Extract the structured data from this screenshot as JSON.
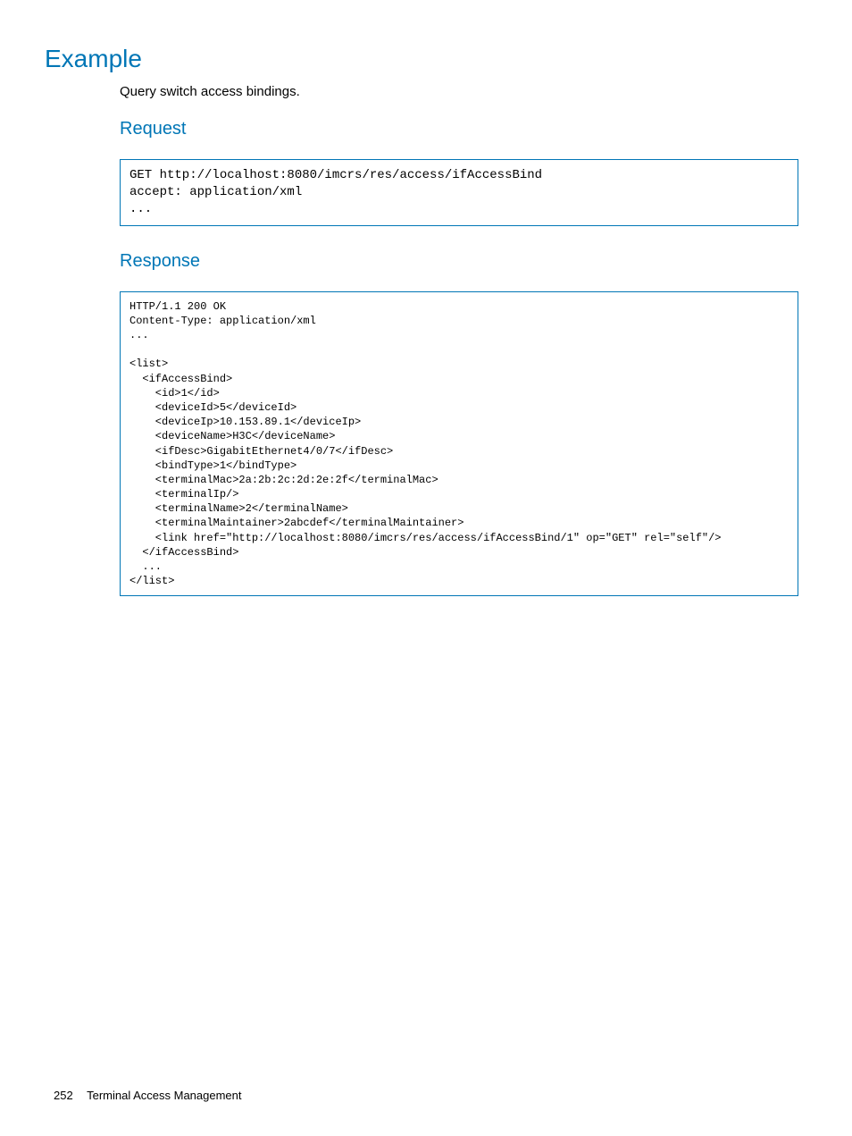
{
  "headings": {
    "example": "Example",
    "request": "Request",
    "response": "Response"
  },
  "intro": "Query switch access bindings.",
  "request_code": "GET http://localhost:8080/imcrs/res/access/ifAccessBind\naccept: application/xml\n...",
  "response_code": "HTTP/1.1 200 OK\nContent-Type: application/xml\n...\n\n<list>\n  <ifAccessBind>\n    <id>1</id>\n    <deviceId>5</deviceId>\n    <deviceIp>10.153.89.1</deviceIp>\n    <deviceName>H3C</deviceName>\n    <ifDesc>GigabitEthernet4/0/7</ifDesc>\n    <bindType>1</bindType>\n    <terminalMac>2a:2b:2c:2d:2e:2f</terminalMac>\n    <terminalIp/>\n    <terminalName>2</terminalName>\n    <terminalMaintainer>2abcdef</terminalMaintainer>\n    <link href=\"http://localhost:8080/imcrs/res/access/ifAccessBind/1\" op=\"GET\" rel=\"self\"/>\n  </ifAccessBind>\n  ...\n</list>",
  "footer": {
    "page": "252",
    "section": "Terminal Access Management"
  }
}
